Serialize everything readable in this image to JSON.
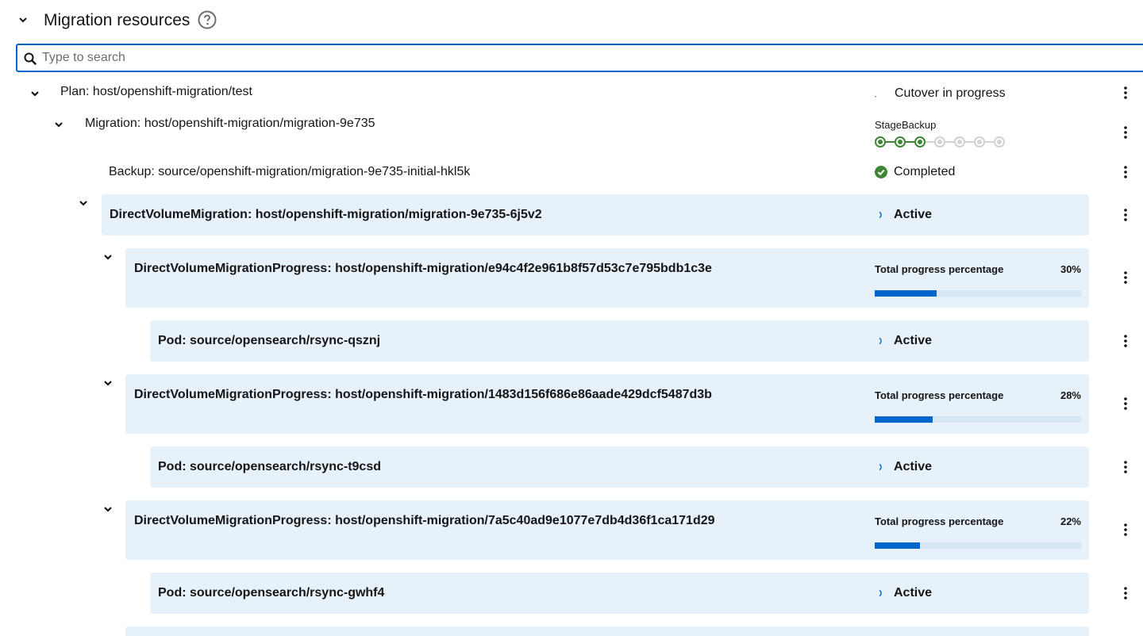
{
  "section": {
    "title": "Migration resources",
    "search_placeholder": "Type to search"
  },
  "plan": {
    "label": "Plan: host/openshift-migration/test",
    "status": "Cutover in progress"
  },
  "migration": {
    "label": "Migration: host/openshift-migration/migration-9e735",
    "step_label": "StageBackup",
    "steps_total": 7,
    "steps_completed": 3
  },
  "backup": {
    "label": "Backup: source/openshift-migration/migration-9e735-initial-hkl5k",
    "status": "Completed"
  },
  "dvm": {
    "label": "DirectVolumeMigration: host/openshift-migration/migration-9e735-6j5v2",
    "status": "Active"
  },
  "progress_items": [
    {
      "label": "DirectVolumeMigrationProgress: host/openshift-migration/e94c4f2e961b8f57d53c7e795bdb1c3e",
      "progress_label": "Total progress percentage",
      "percent_text": "30%",
      "percent": 30,
      "pod": {
        "label": "Pod: source/opensearch/rsync-qsznj",
        "status": "Active"
      }
    },
    {
      "label": "DirectVolumeMigrationProgress: host/openshift-migration/1483d156f686e86aade429dcf5487d3b",
      "progress_label": "Total progress percentage",
      "percent_text": "28%",
      "percent": 28,
      "pod": {
        "label": "Pod: source/opensearch/rsync-t9csd",
        "status": "Active"
      }
    },
    {
      "label": "DirectVolumeMigrationProgress: host/openshift-migration/7a5c40ad9e1077e7db4d36f1ca171d29",
      "progress_label": "Total progress percentage",
      "percent_text": "22%",
      "percent": 22,
      "pod": {
        "label": "Pod: source/opensearch/rsync-gwhf4",
        "status": "Active"
      }
    }
  ],
  "colors": {
    "accent": "#0066cc",
    "success": "#3e8635",
    "card_bg": "#e7f1fa"
  }
}
